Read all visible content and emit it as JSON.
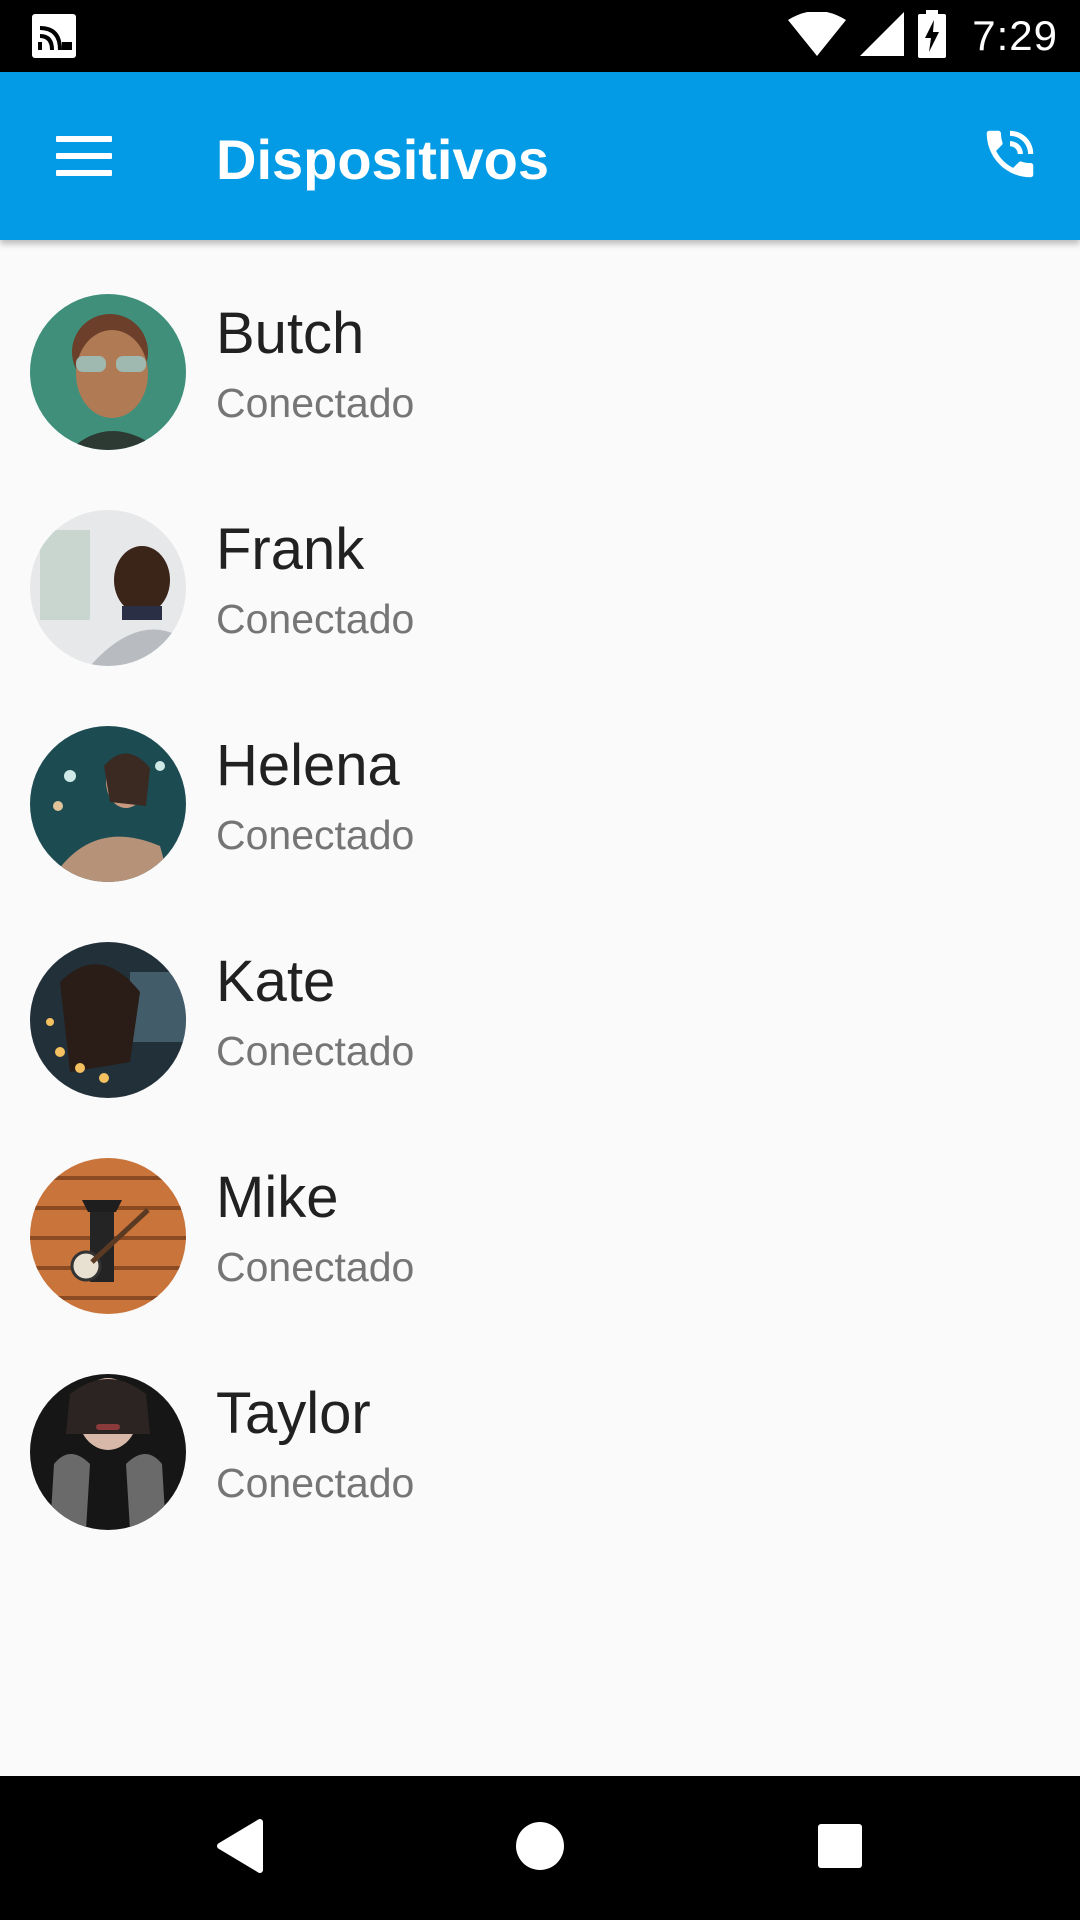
{
  "status_bar": {
    "time": "7:29",
    "icons": [
      "cast-signal-icon",
      "wifi-icon",
      "cell-signal-icon",
      "battery-charging-icon"
    ]
  },
  "app_bar": {
    "title": "Dispositivos",
    "menu_icon": "menu-icon",
    "action_icon": "phone-call-icon",
    "color": "#039be5"
  },
  "devices": [
    {
      "name": "Butch",
      "status": "Conectado",
      "avatar": "avatar-photo"
    },
    {
      "name": "Frank",
      "status": "Conectado",
      "avatar": "avatar-photo"
    },
    {
      "name": "Helena",
      "status": "Conectado",
      "avatar": "avatar-photo"
    },
    {
      "name": "Kate",
      "status": "Conectado",
      "avatar": "avatar-photo"
    },
    {
      "name": "Mike",
      "status": "Conectado",
      "avatar": "avatar-photo"
    },
    {
      "name": "Taylor",
      "status": "Conectado",
      "avatar": "avatar-photo"
    }
  ],
  "nav_bar": {
    "icons": [
      "back-icon",
      "home-icon",
      "recents-icon"
    ]
  }
}
